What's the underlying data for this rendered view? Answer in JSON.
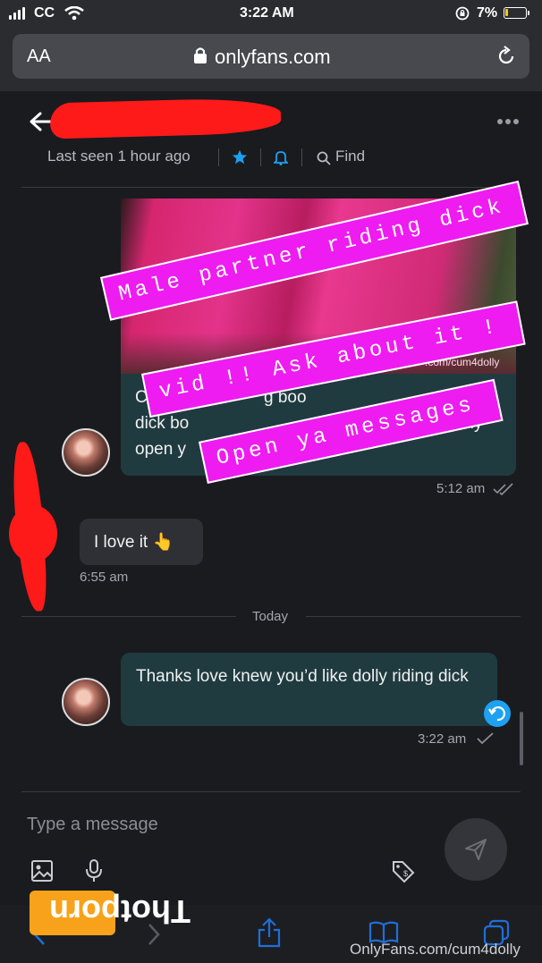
{
  "status_bar": {
    "carrier": "CC",
    "time": "3:22 AM",
    "battery": "7%"
  },
  "browser": {
    "text_size_label": "AA",
    "url": "onlyfans.com"
  },
  "chat_header": {
    "last_seen": "Last seen 1 hour ago",
    "find_label": "Find"
  },
  "messages": [
    {
      "id": "m1",
      "text_lines": [
        "dick bo",
        "open y"
      ],
      "partial_top": "C",
      "partial_mid": "g boo",
      "partial_right": "olly",
      "partial_right2": "ily",
      "time": "5:12 am"
    },
    {
      "id": "m2",
      "text": "I love it 👆",
      "time": "6:55 am"
    },
    {
      "id": "m3",
      "text": "Thanks love knew you’d like dolly riding dick",
      "time": "3:22 am"
    }
  ],
  "date_separator": "Today",
  "media_watermark": ".com/cum4dolly",
  "overlay_banners": [
    "Male partner riding dick",
    "vid !! Ask about it !",
    "Open ya messages"
  ],
  "compose": {
    "placeholder": "Type a message"
  },
  "watermarks": {
    "site_logo": "Thotporn",
    "source": "OnlyFans.com/cum4dolly"
  }
}
